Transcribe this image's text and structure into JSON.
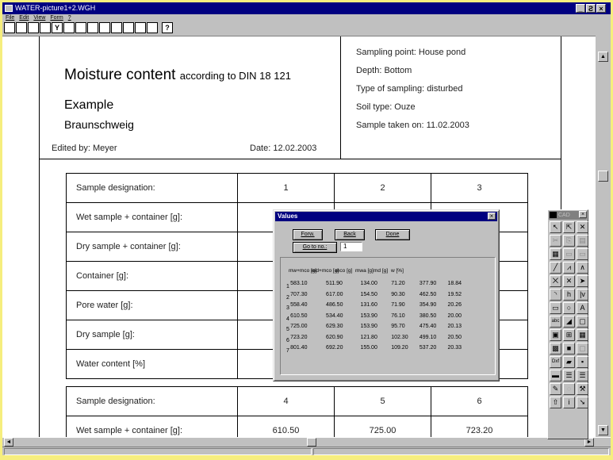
{
  "window": {
    "title": "WATER-picture1+2.WGH",
    "min": "_",
    "max": "Ƨ",
    "close": "×"
  },
  "menu": [
    {
      "label": "File"
    },
    {
      "label": "Edit"
    },
    {
      "label": "View"
    },
    {
      "label": "Form"
    },
    {
      "label": "?"
    }
  ],
  "toolbar": {
    "buttons": [
      {
        "name": "new-icon",
        "glyph": ""
      },
      {
        "name": "open-icon",
        "glyph": ""
      },
      {
        "name": "save-icon",
        "glyph": ""
      },
      {
        "name": "print-icon",
        "glyph": ""
      },
      {
        "name": "filter-icon",
        "glyph": "Y"
      },
      {
        "name": "preview-icon",
        "glyph": ""
      },
      {
        "name": "zoom-in-icon",
        "glyph": ""
      },
      {
        "name": "zoom-out-icon",
        "glyph": ""
      },
      {
        "name": "window-icon",
        "glyph": ""
      },
      {
        "name": "cursor-icon",
        "glyph": ""
      },
      {
        "name": "undo-icon",
        "glyph": ""
      },
      {
        "name": "grid-icon",
        "glyph": ""
      },
      {
        "name": "tools-icon",
        "glyph": ""
      }
    ],
    "help": "?"
  },
  "header": {
    "title": "Moisture content",
    "title_suffix": "according to DIN 18 121",
    "sub1": "Example",
    "sub2": "Braunschweig",
    "edited": "Edited by:  Meyer",
    "date": "Date:  12.02.2003",
    "right": [
      "Sampling point:  House pond",
      "Depth:  Bottom",
      "Type of sampling:  disturbed",
      "Soil type:  Ouze",
      "Sample taken on:  11.02.2003"
    ]
  },
  "table1": {
    "rows": [
      {
        "label": "Sample designation:",
        "cells": [
          "1",
          "2",
          "3"
        ]
      },
      {
        "label": "Wet sample + container [g]:",
        "cells": [
          "",
          "",
          ""
        ]
      },
      {
        "label": "Dry sample + container [g]:",
        "cells": [
          "",
          "",
          ""
        ]
      },
      {
        "label": "Container [g]:",
        "cells": [
          "",
          "",
          ""
        ]
      },
      {
        "label": "Pore water [g]:",
        "cells": [
          "",
          "",
          ""
        ]
      },
      {
        "label": "Dry sample [g]:",
        "cells": [
          "",
          "",
          ""
        ]
      },
      {
        "label": "Water content [%]",
        "cells": [
          "",
          "",
          ""
        ]
      }
    ]
  },
  "table2": {
    "rows": [
      {
        "label": "Sample designation:",
        "cells": [
          "4",
          "5",
          "6"
        ]
      },
      {
        "label": "Wet sample + container [g]:",
        "cells": [
          "610.50",
          "725.00",
          "723.20"
        ]
      }
    ]
  },
  "dialog": {
    "title": "Values",
    "close": "×",
    "forw": "Forw.",
    "back": "Back",
    "done": "Done",
    "goto": "Go to no.:",
    "goto_value": "1",
    "headers": [
      "mw+mco [g]",
      "md+mco [g]",
      "mco [g]",
      "mwa [g]",
      "md [g]",
      "w [%]"
    ],
    "rows": [
      {
        "n": "1",
        "v": [
          "583.10",
          "511.90",
          "134.00",
          "71.20",
          "377.90",
          "18.84"
        ]
      },
      {
        "n": "2",
        "v": [
          "707.30",
          "617.00",
          "154.50",
          "90.30",
          "462.50",
          "19.52"
        ]
      },
      {
        "n": "3",
        "v": [
          "558.40",
          "486.50",
          "131.60",
          "71.90",
          "354.90",
          "20.26"
        ]
      },
      {
        "n": "4",
        "v": [
          "610.50",
          "534.40",
          "153.90",
          "76.10",
          "380.50",
          "20.00"
        ]
      },
      {
        "n": "5",
        "v": [
          "725.00",
          "629.30",
          "153.90",
          "95.70",
          "475.40",
          "20.13"
        ]
      },
      {
        "n": "6",
        "v": [
          "723.20",
          "620.90",
          "121.80",
          "102.30",
          "499.10",
          "20.50"
        ]
      },
      {
        "n": "7",
        "v": [
          "801.40",
          "692.20",
          "155.00",
          "109.20",
          "537.20",
          "20.33"
        ]
      }
    ]
  },
  "cad": {
    "title": "CAD",
    "close": "×",
    "tools": [
      {
        "name": "select-icon",
        "glyph": "↖",
        "g": false
      },
      {
        "name": "move-icon",
        "glyph": "⇱",
        "g": false
      },
      {
        "name": "delete-icon",
        "glyph": "✕",
        "g": false
      },
      {
        "name": "cut-icon",
        "glyph": "✂",
        "g": true
      },
      {
        "name": "copy-icon",
        "glyph": "⎘",
        "g": true
      },
      {
        "name": "paste-icon",
        "glyph": "▤",
        "g": true
      },
      {
        "name": "layer-icon",
        "glyph": "▦",
        "g": false
      },
      {
        "name": "layer-copy-icon",
        "glyph": "▭",
        "g": true
      },
      {
        "name": "layer-paste-icon",
        "glyph": "▭",
        "g": true
      },
      {
        "name": "line-icon",
        "glyph": "╱",
        "g": false
      },
      {
        "name": "polyline-icon",
        "glyph": "⩘",
        "g": false
      },
      {
        "name": "curve-icon",
        "glyph": "∧",
        "g": false
      },
      {
        "name": "cross-line-icon",
        "glyph": "⨉",
        "g": false
      },
      {
        "name": "cross-red-icon",
        "glyph": "✕",
        "g": false
      },
      {
        "name": "arrow-icon",
        "glyph": "➤",
        "g": false
      },
      {
        "name": "arc-icon",
        "glyph": "◝",
        "g": false
      },
      {
        "name": "dimension-icon",
        "glyph": "h",
        "g": false
      },
      {
        "name": "vertical-dimension-icon",
        "glyph": "|v",
        "g": false
      },
      {
        "name": "rectangle-icon",
        "glyph": "▭",
        "g": false
      },
      {
        "name": "circle-icon",
        "glyph": "○",
        "g": false
      },
      {
        "name": "text-icon",
        "glyph": "A",
        "g": false
      },
      {
        "name": "abc-icon",
        "glyph": "abc",
        "g": false
      },
      {
        "name": "chart-icon",
        "glyph": "◢",
        "g": false
      },
      {
        "name": "frame-icon",
        "glyph": "▢",
        "g": false
      },
      {
        "name": "image-icon",
        "glyph": "▣",
        "g": false
      },
      {
        "name": "grid-table-icon",
        "glyph": "⊞",
        "g": false
      },
      {
        "name": "table-icon",
        "glyph": "▦",
        "g": false
      },
      {
        "name": "color-icon",
        "glyph": "▩",
        "g": false
      },
      {
        "name": "stop-icon",
        "glyph": "■",
        "g": false
      },
      {
        "name": "disabled-icon",
        "glyph": "▢",
        "g": true
      },
      {
        "name": "dxf-icon",
        "glyph": "Dxf",
        "g": false
      },
      {
        "name": "folder-icon",
        "glyph": "▰",
        "g": false
      },
      {
        "name": "floppy-icon",
        "glyph": "▪",
        "g": false
      },
      {
        "name": "bar-left-icon",
        "glyph": "▬",
        "g": false
      },
      {
        "name": "bar-mid-icon",
        "glyph": "☰",
        "g": false
      },
      {
        "name": "bar-right-icon",
        "glyph": "☰",
        "g": false
      },
      {
        "name": "pen-icon",
        "glyph": "✎",
        "g": false
      },
      {
        "name": "disabled-shape-icon",
        "glyph": "◌",
        "g": true
      },
      {
        "name": "hammer-icon",
        "glyph": "⚒",
        "g": false
      },
      {
        "name": "up-icon",
        "glyph": "⇧",
        "g": false
      },
      {
        "name": "info-icon",
        "glyph": "i",
        "g": false
      },
      {
        "name": "pointer-icon",
        "glyph": "➘",
        "g": false
      }
    ]
  },
  "scroll": {
    "up": "▲",
    "down": "▼",
    "left": "◄",
    "right": "►"
  }
}
